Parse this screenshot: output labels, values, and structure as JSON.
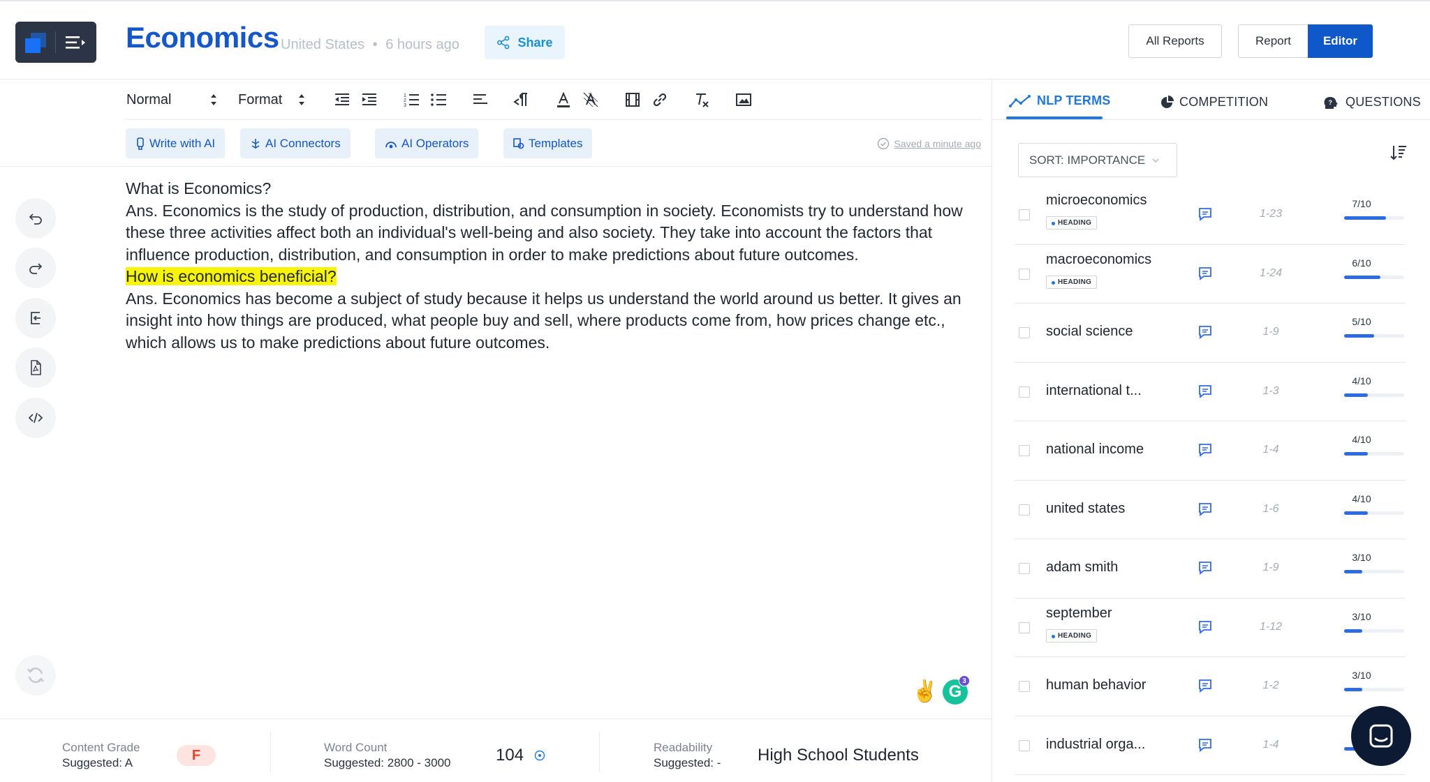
{
  "header": {
    "title": "Economics",
    "location": "United States",
    "separator": "•",
    "time": "6 hours ago",
    "share_label": "Share",
    "all_reports_label": "All Reports",
    "report_label": "Report",
    "editor_label": "Editor"
  },
  "toolbar": {
    "style_select": "Normal",
    "format_select": "Format"
  },
  "ai_tools": {
    "write_label": "Write with AI",
    "connectors_label": "AI Connectors",
    "operators_label": "AI Operators",
    "templates_label": "Templates",
    "saved_status": "Saved a minute ago"
  },
  "content": {
    "q1": "What is Economics?",
    "a1": "Ans. Economics is the study of production, distribution, and consumption in society. Economists try to understand how these three activities affect both an individual's well-being and also society. They take into account the factors that influence production, distribution, and consumption in order to make predictions about future outcomes.",
    "q2": "How is economics beneficial?",
    "a2": "Ans. Economics has become a subject of study because it helps us understand the world around us better. It gives an insight into how things are produced, what people buy and sell, where products come from, how prices change etc., which allows us to make predictions about future outcomes."
  },
  "grammarly_count": "3",
  "footer": {
    "content_grade_label": "Content Grade",
    "content_grade_suggested": "Suggested: A",
    "content_grade_value": "F",
    "word_count_label": "Word Count",
    "word_count_suggested": "Suggested: 2800 - 3000",
    "word_count_value": "104",
    "readability_label": "Readability",
    "readability_suggested": "Suggested: -",
    "readability_value": "High School Students"
  },
  "panel": {
    "tabs": [
      {
        "label": "NLP TERMS",
        "active": true
      },
      {
        "label": "COMPETITION",
        "active": false
      },
      {
        "label": "QUESTIONS",
        "active": false
      }
    ],
    "sort_label": "SORT: IMPORTANCE",
    "heading_tag": "HEADING",
    "terms": [
      {
        "name": "microeconomics",
        "heading": true,
        "range": "1-23",
        "score": "7/10",
        "level": 0.7
      },
      {
        "name": "macroeconomics",
        "heading": true,
        "range": "1-24",
        "score": "6/10",
        "level": 0.6
      },
      {
        "name": "social science",
        "heading": false,
        "range": "1-9",
        "score": "5/10",
        "level": 0.5
      },
      {
        "name": "international t...",
        "heading": false,
        "range": "1-3",
        "score": "4/10",
        "level": 0.4
      },
      {
        "name": "national income",
        "heading": false,
        "range": "1-4",
        "score": "4/10",
        "level": 0.4
      },
      {
        "name": "united states",
        "heading": false,
        "range": "1-6",
        "score": "4/10",
        "level": 0.4
      },
      {
        "name": "adam smith",
        "heading": false,
        "range": "1-9",
        "score": "3/10",
        "level": 0.3
      },
      {
        "name": "september",
        "heading": true,
        "range": "1-12",
        "score": "3/10",
        "level": 0.3
      },
      {
        "name": "human behavior",
        "heading": false,
        "range": "1-2",
        "score": "3/10",
        "level": 0.3
      },
      {
        "name": "industrial orga...",
        "heading": false,
        "range": "1-4",
        "score": "",
        "level": 0.3
      }
    ]
  },
  "colors": {
    "brand_blue": "#1357c9",
    "accent": "#1f79dd",
    "highlight": "#f7f40a",
    "grade_fail": "#e8412c"
  }
}
